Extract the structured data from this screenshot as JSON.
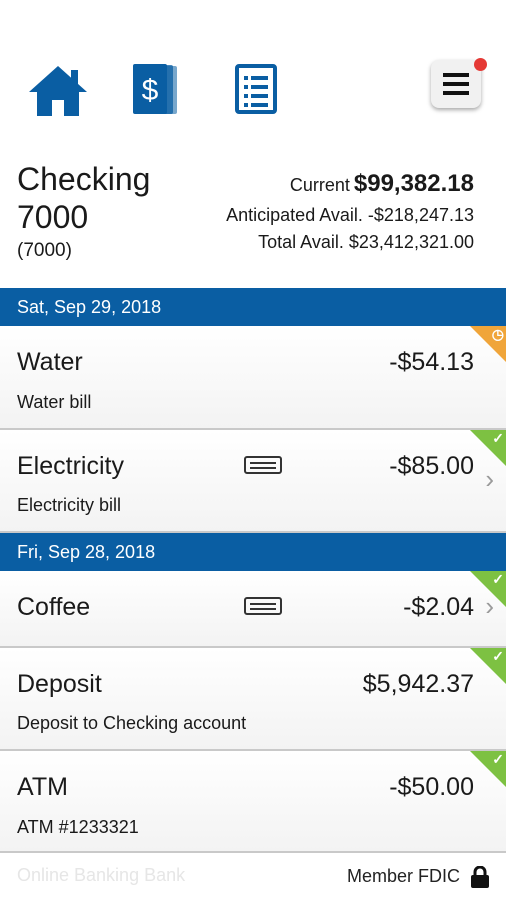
{
  "nav": {
    "icons": [
      "home-icon",
      "accounts-dollar-icon",
      "statements-list-icon",
      "menu-hamburger-icon"
    ],
    "brand_color": "#0a5ea3",
    "notification_color": "#e53935"
  },
  "account": {
    "name": "Checking 7000",
    "number": "(7000)",
    "current_label": "Current",
    "current_value": "$99,382.18",
    "anticipated": "Anticipated Avail. -$218,247.13",
    "total": "Total Avail. $23,412,321.00"
  },
  "groups": [
    {
      "date": "Sat, Sep 29, 2018",
      "transactions": [
        {
          "name": "Water",
          "description": "Water bill",
          "amount": "-$54.13",
          "status": "pending"
        },
        {
          "name": "Electricity",
          "description": "Electricity bill",
          "amount": "-$85.00",
          "status": "cleared"
        }
      ]
    },
    {
      "date": "Fri, Sep 28, 2018",
      "transactions": [
        {
          "name": "Coffee",
          "description": "",
          "amount": "-$2.04",
          "status": "cleared"
        },
        {
          "name": "Deposit",
          "description": "Deposit to Checking account",
          "amount": "$5,942.37",
          "status": "cleared"
        },
        {
          "name": "ATM",
          "description": "ATM #1233321",
          "amount": "-$50.00",
          "status": "cleared"
        }
      ]
    }
  ],
  "footer": {
    "bank_name": "Online Banking Bank",
    "fdic": "Member FDIC"
  },
  "colors": {
    "pending": "#f0a53a",
    "cleared": "#7dc142",
    "date_bar": "#0a5ea3"
  }
}
